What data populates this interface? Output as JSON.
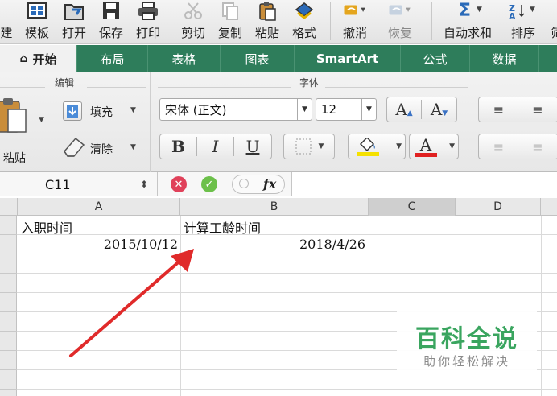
{
  "toolbar": {
    "items": [
      {
        "label": "建",
        "icon": "new-icon"
      },
      {
        "label": "模板",
        "icon": "template-icon"
      },
      {
        "label": "打开",
        "icon": "open-icon"
      },
      {
        "label": "保存",
        "icon": "save-icon"
      },
      {
        "label": "打印",
        "icon": "print-icon"
      },
      {
        "label": "剪切",
        "icon": "cut-icon"
      },
      {
        "label": "复制",
        "icon": "copy-icon"
      },
      {
        "label": "粘贴",
        "icon": "paste-icon"
      },
      {
        "label": "格式",
        "icon": "format-painter-icon"
      },
      {
        "label": "撤消",
        "icon": "undo-icon"
      },
      {
        "label": "恢复",
        "icon": "redo-icon"
      },
      {
        "label": "自动求和",
        "icon": "autosum-icon"
      },
      {
        "label": "排序",
        "icon": "sort-icon"
      },
      {
        "label": "筛",
        "icon": "filter-icon"
      }
    ]
  },
  "tabs": [
    "开始",
    "布局",
    "表格",
    "图表",
    "SmartArt",
    "公式",
    "数据"
  ],
  "active_tab": "开始",
  "ribbon": {
    "edit_group_title": "编辑",
    "font_group_title": "字体",
    "fill_label": "填充",
    "clear_label": "清除",
    "paste_label": "粘贴",
    "font_name": "宋体 (正文)",
    "font_size": "12",
    "grow_font": "A",
    "shrink_font": "A",
    "bold": "B",
    "italic": "I",
    "underline": "U",
    "font_color_letter": "A",
    "fill_color": "#f5e100",
    "font_color": "#e02020"
  },
  "formula_bar": {
    "cell_ref": "C11",
    "fx": "fx",
    "value": ""
  },
  "sheet": {
    "columns": [
      "A",
      "B",
      "C",
      "D"
    ],
    "selected_column": "C",
    "cells": {
      "A1": "入职时间",
      "B1": "计算工龄时间",
      "A2": "2015/10/12",
      "B2": "2018/4/26"
    }
  },
  "watermark": {
    "title": "百科全说",
    "subtitle": "助你轻松解决"
  }
}
